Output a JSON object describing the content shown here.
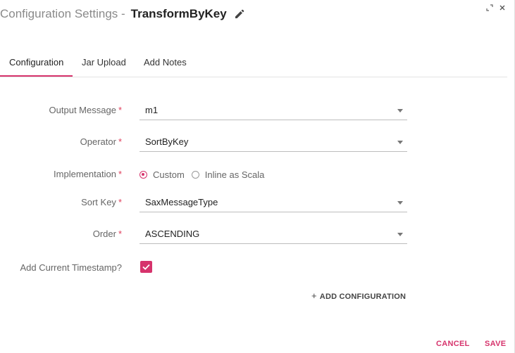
{
  "header": {
    "title_prefix": "Configuration Settings -",
    "component_name": "TransformByKey"
  },
  "window_controls": {
    "expand_icon": "expand-icon",
    "close_icon": "close-icon"
  },
  "tabs": [
    {
      "label": "Configuration",
      "active": true
    },
    {
      "label": "Jar Upload",
      "active": false
    },
    {
      "label": "Add Notes",
      "active": false
    }
  ],
  "form": {
    "required_marker": "*",
    "output_message": {
      "label": "Output Message",
      "value": "m1"
    },
    "operator": {
      "label": "Operator",
      "value": "SortByKey"
    },
    "implementation": {
      "label": "Implementation",
      "options": [
        "Custom",
        "Inline as Scala"
      ],
      "selected": "Custom"
    },
    "sort_key": {
      "label": "Sort Key",
      "value": "SaxMessageType"
    },
    "order": {
      "label": "Order",
      "value": "ASCENDING"
    },
    "add_current_timestamp": {
      "label": "Add Current Timestamp?",
      "checked": true
    }
  },
  "add_configuration": {
    "plus": "+",
    "label": "ADD CONFIGURATION"
  },
  "footer": {
    "cancel_label": "CANCEL",
    "save_label": "SAVE"
  },
  "colors": {
    "accent": "#d6336c",
    "label": "#666666",
    "tab_border": "#e4e4e4"
  }
}
